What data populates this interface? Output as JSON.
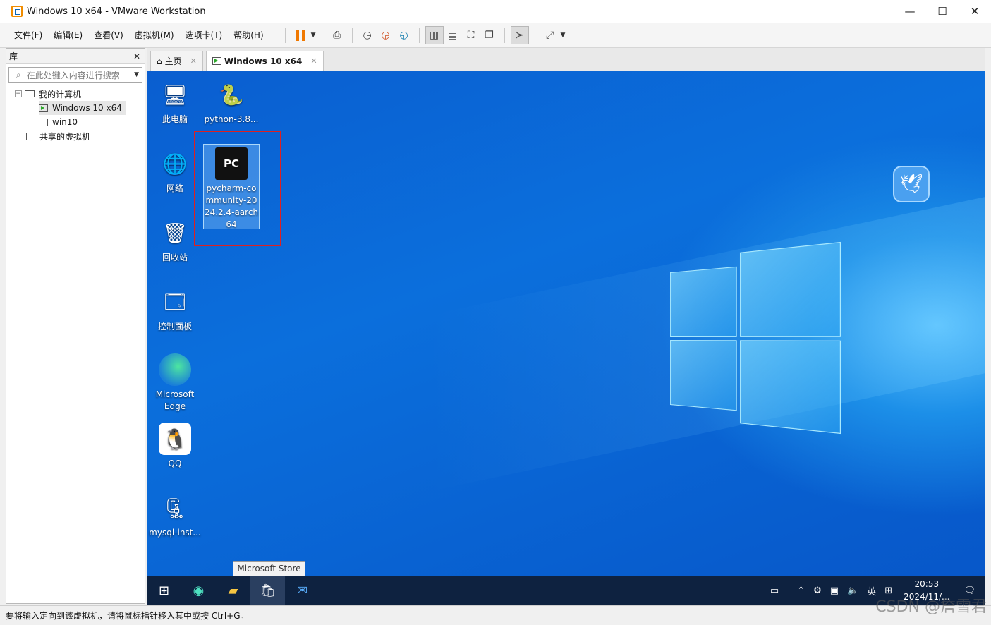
{
  "window": {
    "title": "Windows 10 x64 - VMware Workstation"
  },
  "menu": [
    "文件(F)",
    "编辑(E)",
    "查看(V)",
    "虚拟机(M)",
    "选项卡(T)",
    "帮助(H)"
  ],
  "library": {
    "title": "库",
    "close": "✕",
    "search_placeholder": "在此处键入内容进行搜索",
    "tree": {
      "root": "我的计算机",
      "vm1": "Windows 10 x64",
      "vm2": "win10",
      "shared": "共享的虚拟机"
    }
  },
  "tabs": {
    "home": "主页",
    "vm": "Windows 10 x64"
  },
  "desktop": {
    "icons": {
      "this_pc": "此电脑",
      "python": "python-3.8...",
      "network": "网络",
      "pycharm": "pycharm-community-2024.2.4-aarch64",
      "recycle": "回收站",
      "control_panel": "控制面板",
      "edge_1": "Microsoft",
      "edge_2": "Edge",
      "qq": "QQ",
      "mysql": "mysql-inst..."
    },
    "tooltip": "Microsoft Store"
  },
  "tray": {
    "lang": "英",
    "time": "20:53",
    "date": "2024/11/..."
  },
  "status": "要将输入定向到该虚拟机，请将鼠标指针移入其中或按 Ctrl+G。",
  "watermark": "CSDN @詹雪君",
  "colors": {
    "accent_orange": "#f07800",
    "selection_red": "#e02020",
    "taskbar": "#0e2240"
  }
}
